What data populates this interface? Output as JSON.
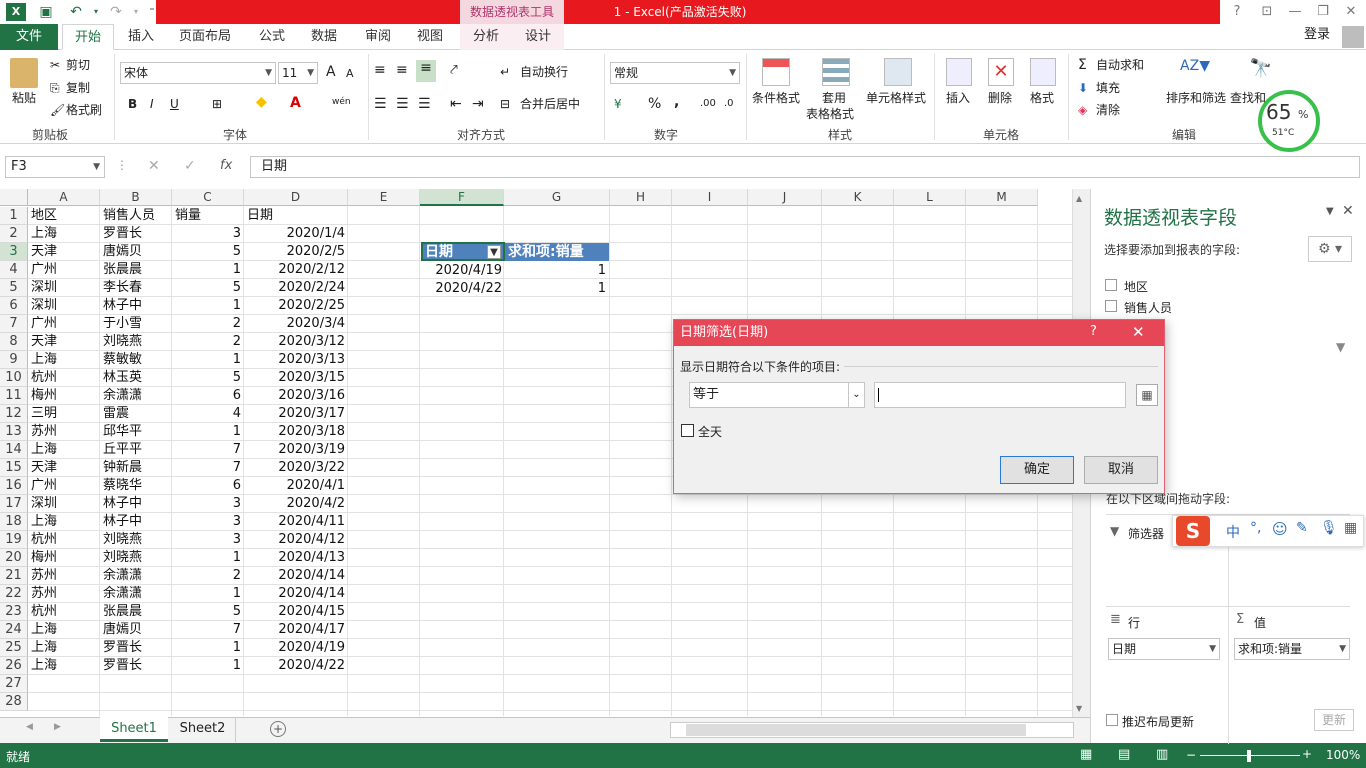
{
  "window": {
    "title": "1 - Excel(产品激活失败)",
    "context_label": "数据透视表工具",
    "help": "?",
    "login": "登录"
  },
  "tabs": [
    "文件",
    "开始",
    "插入",
    "页面布局",
    "公式",
    "数据",
    "审阅",
    "视图",
    "分析",
    "设计"
  ],
  "ribbon": {
    "clipboard": {
      "paste": "粘贴",
      "cut": "剪切",
      "copy": "复制",
      "format_painter": "格式刷",
      "group": "剪贴板"
    },
    "font": {
      "name": "宋体",
      "size": "11",
      "bold": "B",
      "italic": "I",
      "underline": "U",
      "grow": "A",
      "shrink": "A",
      "group": "字体",
      "wen": "wén"
    },
    "alignment": {
      "wrap": "自动换行",
      "merge": "合并后居中",
      "group": "对齐方式"
    },
    "number": {
      "format": "常规",
      "percent": "%",
      "comma": ",",
      "group": "数字"
    },
    "styles": {
      "conditional": "条件格式",
      "table": "套用",
      "table2": "表格格式",
      "cell": "单元格样式",
      "group": "样式"
    },
    "cells": {
      "insert": "插入",
      "delete": "删除",
      "format": "格式",
      "group": "单元格"
    },
    "editing": {
      "autosum": "自动求和",
      "fill": "填充",
      "clear": "清除",
      "sort": "排序和筛选",
      "find": "查找和",
      "group": "编辑"
    }
  },
  "meter": {
    "percent": "65",
    "unit": "%",
    "temp": "51°C"
  },
  "formula": {
    "namebox": "F3",
    "content": "日期",
    "fx": "fx"
  },
  "columns": [
    "A",
    "B",
    "C",
    "D",
    "E",
    "F",
    "G",
    "H",
    "I",
    "J",
    "K",
    "L",
    "M"
  ],
  "rows": [
    [
      "地区",
      "销售人员",
      "销量",
      "日期"
    ],
    [
      "上海",
      "罗晋长",
      "3",
      "2020/1/4"
    ],
    [
      "天津",
      "唐嫣贝",
      "5",
      "2020/2/5"
    ],
    [
      "广州",
      "张晨晨",
      "1",
      "2020/2/12"
    ],
    [
      "深圳",
      "李长春",
      "5",
      "2020/2/24"
    ],
    [
      "深圳",
      "林子中",
      "1",
      "2020/2/25"
    ],
    [
      "广州",
      "于小雪",
      "2",
      "2020/3/4"
    ],
    [
      "天津",
      "刘晓燕",
      "2",
      "2020/3/12"
    ],
    [
      "上海",
      "蔡敏敏",
      "1",
      "2020/3/13"
    ],
    [
      "杭州",
      "林玉英",
      "5",
      "2020/3/15"
    ],
    [
      "梅州",
      "余潇潇",
      "6",
      "2020/3/16"
    ],
    [
      "三明",
      "雷震",
      "4",
      "2020/3/17"
    ],
    [
      "苏州",
      "邱华平",
      "1",
      "2020/3/18"
    ],
    [
      "上海",
      "丘平平",
      "7",
      "2020/3/19"
    ],
    [
      "天津",
      "钟新晨",
      "7",
      "2020/3/22"
    ],
    [
      "广州",
      "蔡晓华",
      "6",
      "2020/4/1"
    ],
    [
      "深圳",
      "林子中",
      "3",
      "2020/4/2"
    ],
    [
      "上海",
      "林子中",
      "3",
      "2020/4/11"
    ],
    [
      "杭州",
      "刘晓燕",
      "3",
      "2020/4/12"
    ],
    [
      "梅州",
      "刘晓燕",
      "1",
      "2020/4/13"
    ],
    [
      "苏州",
      "余潇潇",
      "2",
      "2020/4/14"
    ],
    [
      "苏州",
      "余潇潇",
      "1",
      "2020/4/14"
    ],
    [
      "杭州",
      "张晨晨",
      "5",
      "2020/4/15"
    ],
    [
      "上海",
      "唐嫣贝",
      "7",
      "2020/4/17"
    ],
    [
      "上海",
      "罗晋长",
      "1",
      "2020/4/19"
    ],
    [
      "上海",
      "罗晋长",
      "1",
      "2020/4/22"
    ],
    [
      "",
      "",
      "",
      ""
    ],
    [
      "",
      "",
      "",
      ""
    ]
  ],
  "pivot": {
    "header_date": "日期",
    "header_sum": "求和项:销量",
    "rows": [
      [
        "2020/4/19",
        "1"
      ],
      [
        "2020/4/22",
        "1"
      ]
    ]
  },
  "dialog": {
    "title": "日期筛选(日期)",
    "help": "?",
    "prompt": "显示日期符合以下条件的项目:",
    "operator": "等于",
    "value": "",
    "allday": "全天",
    "ok": "确定",
    "cancel": "取消"
  },
  "pane": {
    "title": "数据透视表字段",
    "subtitle": "选择要添加到报表的字段:",
    "fields": [
      "地区",
      "销售人员"
    ],
    "drag_label": "在以下区域间拖动字段:",
    "filter": "筛选器",
    "rows_label": "行",
    "values_label": "值",
    "row_field": "日期",
    "value_field": "求和项:销量",
    "defer": "推迟布局更新",
    "update": "更新"
  },
  "sheets": [
    "Sheet1",
    "Sheet2"
  ],
  "status": {
    "ready": "就绪",
    "zoom": "100%"
  },
  "ime": {
    "lang": "中"
  }
}
